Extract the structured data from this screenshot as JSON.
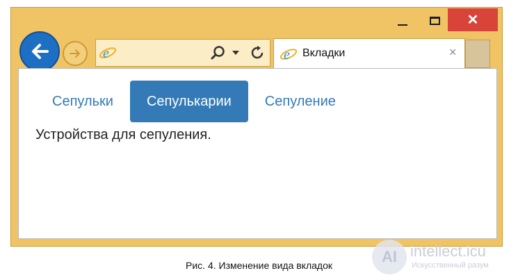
{
  "browser": {
    "tab_title": "Вкладки",
    "tab_close_glyph": "×",
    "close_glyph": "✕"
  },
  "page": {
    "tabs": [
      {
        "label": "Сепульки",
        "active": false
      },
      {
        "label": "Сепулькарии",
        "active": true
      },
      {
        "label": "Сепуление",
        "active": false
      }
    ],
    "content_text": "Устройства для сепуления."
  },
  "caption": "Рис. 4. Изменение вида вкладок",
  "watermark": {
    "logo_text": "AI",
    "title": "intellect.icu",
    "subtitle": "Искусственный разум"
  },
  "colors": {
    "frame": "#f0c465",
    "accent": "#337ab7",
    "close": "#d9443a",
    "back_button": "#1d6fc4"
  },
  "icons": [
    "back-arrow-icon",
    "forward-arrow-icon",
    "ie-logo-icon",
    "search-icon",
    "dropdown-icon",
    "refresh-icon",
    "close-icon",
    "minimize-icon",
    "maximize-icon"
  ]
}
